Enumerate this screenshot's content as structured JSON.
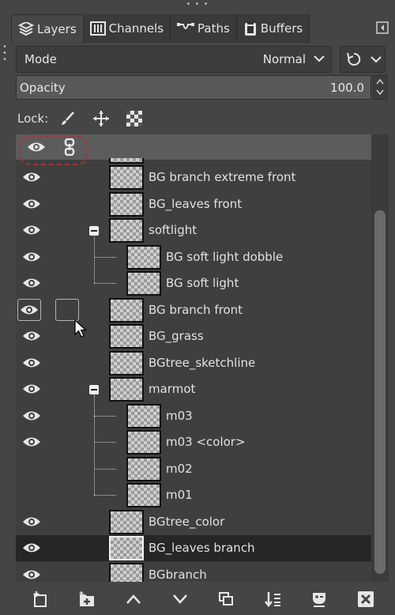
{
  "tabs": [
    {
      "label": "Layers",
      "icon": "layers-icon",
      "active": true
    },
    {
      "label": "Channels",
      "icon": "channels-icon",
      "active": false
    },
    {
      "label": "Paths",
      "icon": "paths-icon",
      "active": false
    },
    {
      "label": "Buffers",
      "icon": "buffers-icon",
      "active": false
    }
  ],
  "mode": {
    "label": "Mode",
    "value": "Normal"
  },
  "opacity": {
    "label": "Opacity",
    "value": "100.0"
  },
  "lock": {
    "label": "Lock:",
    "icons": [
      "paintbrush-icon",
      "move-icon",
      "alpha-lock-icon"
    ]
  },
  "layers": [
    {
      "name": "BG branch extreme front"
    },
    {
      "name": "BG_leaves front"
    },
    {
      "name": "softlight"
    },
    {
      "name": "BG soft light dobble"
    },
    {
      "name": "BG soft light"
    },
    {
      "name": "BG branch front"
    },
    {
      "name": "BG_grass"
    },
    {
      "name": "BGtree_sketchline"
    },
    {
      "name": "marmot"
    },
    {
      "name": "m03"
    },
    {
      "name": "m03 <color>"
    },
    {
      "name": "m02"
    },
    {
      "name": "m01"
    },
    {
      "name": "BGtree_color"
    },
    {
      "name": "BG_leaves branch"
    },
    {
      "name": "BGbranch"
    }
  ],
  "bottom_buttons": [
    "new-layer-icon",
    "new-group-icon",
    "raise-icon",
    "lower-icon",
    "duplicate-icon",
    "merge-down-icon",
    "mask-icon",
    "delete-icon"
  ],
  "colors": {
    "panel": "#454545",
    "list": "#3f3f3f",
    "selected_row": "#262626",
    "header_row": "#5c5c5c",
    "dash_highlight": "#b03030"
  }
}
